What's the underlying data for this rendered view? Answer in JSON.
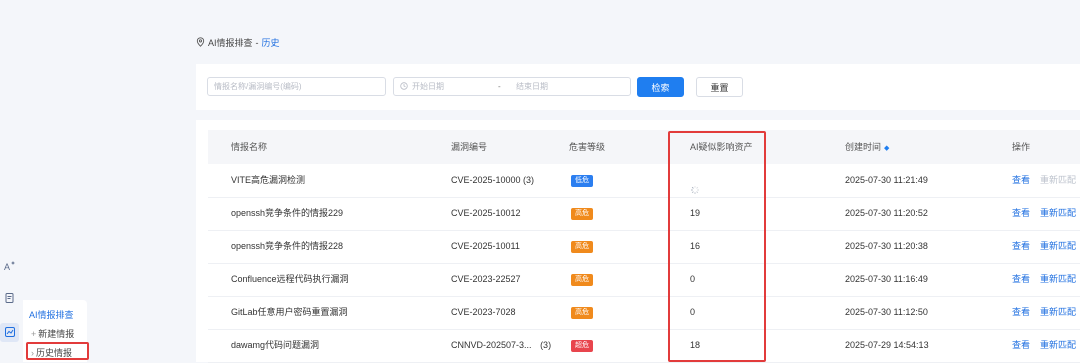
{
  "breadcrumb": {
    "parent": "AI情报排查",
    "separator": "-",
    "current": "历史"
  },
  "filter": {
    "name_placeholder": "情报名称/漏洞编号(编码)",
    "start_placeholder": "开始日期",
    "range_sep": "-",
    "end_placeholder": "结束日期",
    "search_label": "检索",
    "reset_label": "重置"
  },
  "table": {
    "headers": [
      "情报名称",
      "漏洞编号",
      "危害等级",
      "AI疑似影响资产",
      "创建时间",
      "操作"
    ],
    "rows": [
      {
        "name": "VITE高危漏洞检测",
        "vuln": "CVE-2025-10000 (3)",
        "level": "低危",
        "level_color": "#2b7ef0",
        "assets": "",
        "loading": true,
        "time": "2025-07-30 11:21:49",
        "view": "查看",
        "rematch": "重新匹配",
        "rematch_disabled": true
      },
      {
        "name": "openssh竞争条件的情报229",
        "vuln": "CVE-2025-10012",
        "level": "高危",
        "level_color": "#f08a1c",
        "assets": "19",
        "loading": false,
        "time": "2025-07-30 11:20:52",
        "view": "查看",
        "rematch": "重新匹配",
        "rematch_disabled": false
      },
      {
        "name": "openssh竞争条件的情报228",
        "vuln": "CVE-2025-10011",
        "level": "高危",
        "level_color": "#f08a1c",
        "assets": "16",
        "loading": false,
        "time": "2025-07-30 11:20:38",
        "view": "查看",
        "rematch": "重新匹配",
        "rematch_disabled": false
      },
      {
        "name": "Confluence远程代码执行漏洞",
        "vuln": "CVE-2023-22527",
        "level": "高危",
        "level_color": "#f08a1c",
        "assets": "0",
        "loading": false,
        "time": "2025-07-30 11:16:49",
        "view": "查看",
        "rematch": "重新匹配",
        "rematch_disabled": false
      },
      {
        "name": "GitLab任意用户密码重置漏洞",
        "vuln": "CVE-2023-7028",
        "level": "高危",
        "level_color": "#f08a1c",
        "assets": "0",
        "loading": false,
        "time": "2025-07-30 11:12:50",
        "view": "查看",
        "rematch": "重新匹配",
        "rematch_disabled": false
      },
      {
        "name": "dawamg代码问题漏洞",
        "vuln": "CNNVD-202507-3...",
        "vuln_extra": "(3)",
        "level": "超危",
        "level_color": "#e8454d",
        "assets": "18",
        "loading": false,
        "time": "2025-07-29 14:54:13",
        "view": "查看",
        "rematch": "重新匹配",
        "rematch_disabled": false
      }
    ]
  },
  "sidebar": {
    "title": "AI情报排查",
    "items": [
      {
        "label": "新建情报",
        "icon": "plus-icon"
      },
      {
        "label": "历史情报",
        "icon": "chevron-icon"
      }
    ],
    "rail_icons": [
      "ai-sparkle-icon",
      "document-icon",
      "chart-icon"
    ]
  },
  "colors": {
    "accent": "#1f7ef0",
    "highlight_box": "#e23b3b"
  }
}
